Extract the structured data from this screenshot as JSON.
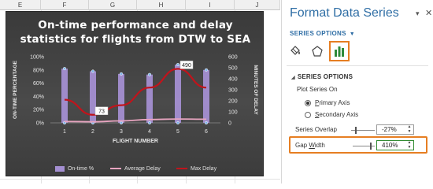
{
  "spreadsheet": {
    "columns": [
      "E",
      "F",
      "G",
      "H",
      "I",
      "J"
    ]
  },
  "chart": {
    "title_line1": "On-time performance and delay",
    "title_line2": "statistics for flights from DTW to SEA"
  },
  "chart_data": {
    "type": "bar",
    "title": "On-time performance and delay statistics for flights from DTW to SEA",
    "xlabel": "FLIGHT NUMBER",
    "ylabel": "ON-TIME PERCENTAGE",
    "y2label": "MINUTES OF DELAY",
    "categories": [
      "1",
      "2",
      "3",
      "4",
      "5",
      "6"
    ],
    "ylim": [
      0,
      100
    ],
    "y_ticks": [
      "0%",
      "20%",
      "40%",
      "60%",
      "80%",
      "100%"
    ],
    "y2lim": [
      0,
      600
    ],
    "y2_ticks": [
      "0",
      "100",
      "200",
      "300",
      "400",
      "500",
      "600"
    ],
    "series": [
      {
        "name": "On-time %",
        "type": "bar",
        "axis": "primary",
        "color": "#a48fd2",
        "values": [
          82,
          78,
          74,
          73,
          88,
          80
        ]
      },
      {
        "name": "Average Delay",
        "type": "line",
        "axis": "secondary",
        "color": "#e8a5c0",
        "values": [
          12,
          10,
          18,
          30,
          35,
          33
        ]
      },
      {
        "name": "Max Delay",
        "type": "line",
        "axis": "secondary",
        "color": "#c0141c",
        "values": [
          210,
          73,
          160,
          320,
          490,
          320
        ]
      }
    ],
    "data_labels": [
      {
        "series": "Max Delay",
        "category": "2",
        "text": "73"
      },
      {
        "series": "Max Delay",
        "category": "5",
        "text": "490"
      }
    ],
    "legend_position": "bottom",
    "grid": false
  },
  "pane": {
    "title": "Format Data Series",
    "dropdown_icon": "▾",
    "close_icon": "✕",
    "series_options_label": "SERIES OPTIONS",
    "section_label": "SERIES OPTIONS",
    "plot_series_on": "Plot Series On",
    "primary_axis_prefix": "P",
    "primary_axis_rest": "rimary Axis",
    "secondary_axis_prefix": "S",
    "secondary_axis_rest": "econdary Axis",
    "primary_axis_selected": true,
    "series_overlap_label": "Series Overlap",
    "series_overlap_value": "-27%",
    "gap_width_label_prefix": "Gap ",
    "gap_width_label_u": "W",
    "gap_width_label_rest": "idth",
    "gap_width_value": "410%"
  },
  "colors": {
    "accent_blue": "#2f6ea5",
    "highlight_orange": "#e67e22",
    "chart_bg": "#3f3f3f"
  }
}
